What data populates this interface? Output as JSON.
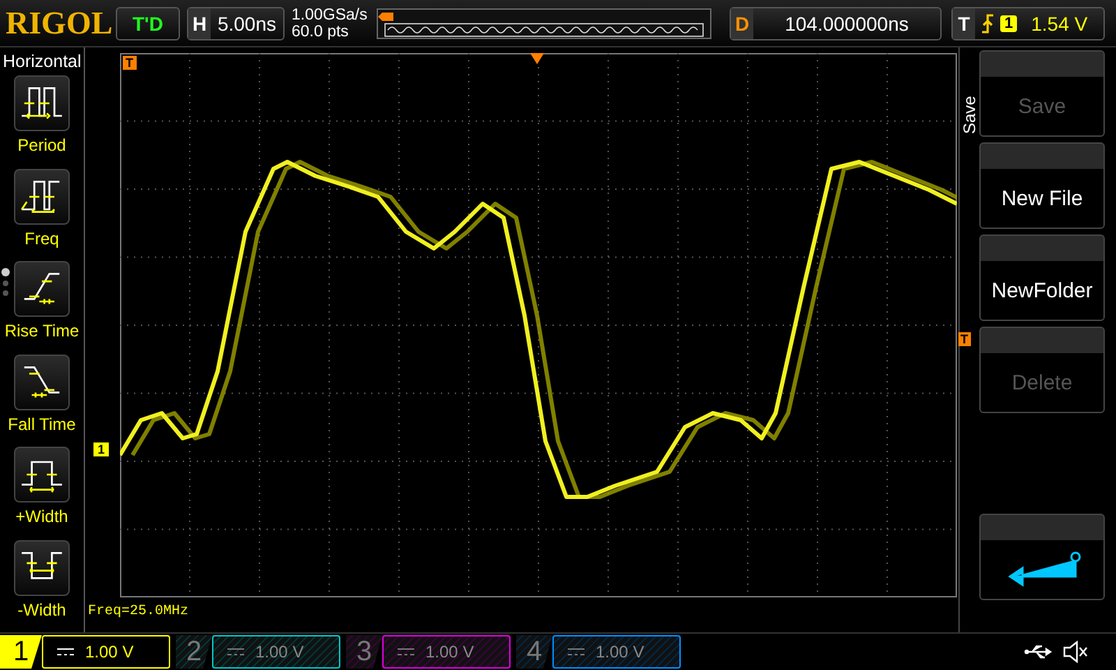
{
  "header": {
    "logo": "RIGOL",
    "run_status": "T'D",
    "horizontal": {
      "label": "H",
      "value": "5.00ns"
    },
    "sample_rate": "1.00GSa/s",
    "memory_depth": "60.0 pts",
    "delay": {
      "label": "D",
      "value": "104.000000ns"
    },
    "trigger": {
      "label": "T",
      "source": "1",
      "level": "1.54 V"
    }
  },
  "measure_menu": {
    "title": "Horizontal",
    "page_dots": [
      {
        "selected": true
      },
      {
        "selected": false
      },
      {
        "selected": false
      }
    ],
    "items": [
      {
        "kind": "period",
        "label": "Period"
      },
      {
        "kind": "freq",
        "label": "Freq"
      },
      {
        "kind": "rise",
        "label": "Rise Time"
      },
      {
        "kind": "fall",
        "label": "Fall Time"
      },
      {
        "kind": "pwidth",
        "label": "+Width"
      },
      {
        "kind": "nwidth",
        "label": "-Width"
      }
    ]
  },
  "display": {
    "position_marker": "T",
    "channel_marker": "1",
    "trigger_level_marker": "T",
    "readout": "Freq=25.0MHz"
  },
  "softkey_menu": {
    "title": "Save",
    "keys": [
      {
        "kind": "text",
        "label": "Save",
        "disabled": true
      },
      {
        "kind": "text",
        "label": "New File",
        "disabled": false
      },
      {
        "kind": "text",
        "label": "NewFolder",
        "disabled": false
      },
      {
        "kind": "text",
        "label": "Delete",
        "disabled": true
      },
      {
        "kind": "back"
      }
    ]
  },
  "channels": [
    {
      "number": "1",
      "scale": "1.00 V",
      "on": true,
      "color": "#ffff00"
    },
    {
      "number": "2",
      "scale": "1.00 V",
      "on": false,
      "color": "#00c8c8"
    },
    {
      "number": "3",
      "scale": "1.00 V",
      "on": false,
      "color": "#e000e0"
    },
    {
      "number": "4",
      "scale": "1.00 V",
      "on": false,
      "color": "#0090ff"
    }
  ]
}
